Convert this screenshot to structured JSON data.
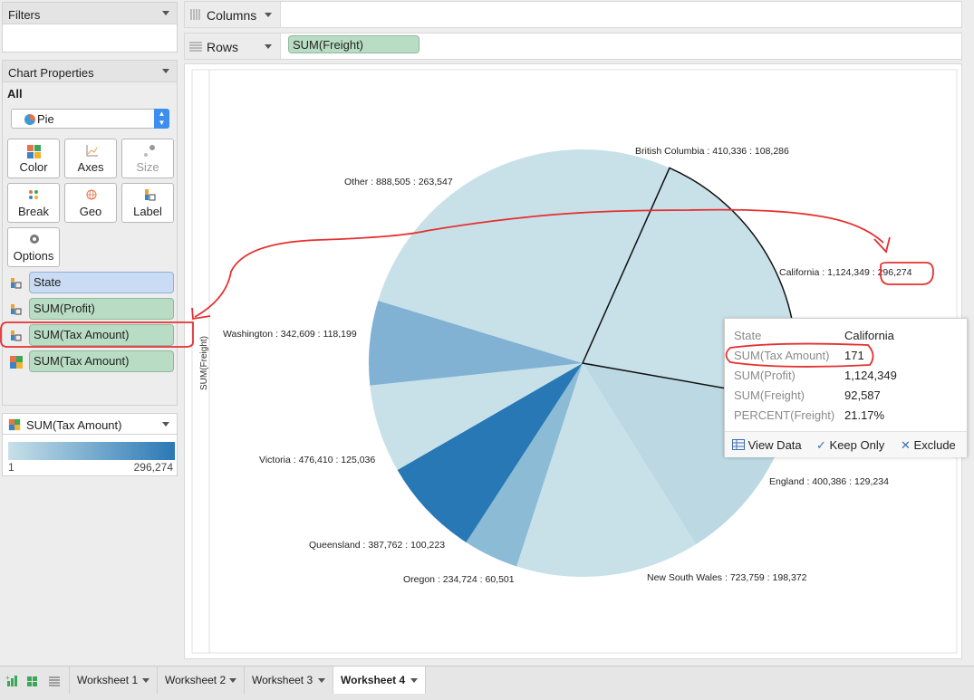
{
  "left_panel": {
    "filters_title": "Filters",
    "chart_properties_title": "Chart Properties",
    "all_label": "All",
    "chart_type": "Pie",
    "buttons": {
      "color": "Color",
      "axes": "Axes",
      "size": "Size",
      "break": "Break",
      "geo": "Geo",
      "label": "Label",
      "options": "Options"
    },
    "fields": [
      {
        "label": "State"
      },
      {
        "label": "SUM(Profit)"
      },
      {
        "label": "SUM(Tax Amount)"
      },
      {
        "label": "SUM(Tax Amount)"
      }
    ],
    "legend": {
      "title": "SUM(Tax Amount)",
      "min": "1",
      "max": "296,274"
    }
  },
  "shelves": {
    "columns_label": "Columns",
    "rows_label": "Rows",
    "rows_pill": "SUM(Freight)"
  },
  "chart": {
    "y_axis_label": "SUM(Freight)"
  },
  "chart_data": {
    "type": "pie",
    "slices": [
      {
        "name": "British Columbia",
        "profit": 410336,
        "tax_amount": 108286,
        "label": "British Columbia : 410,336 : 108,286",
        "color": "#c8e0e8"
      },
      {
        "name": "California",
        "profit": 1124349,
        "tax_amount": 296274,
        "label": "California : 1,124,349 : 296,274",
        "color": "#c8e0e8",
        "freight_percent": 21.17
      },
      {
        "name": "England",
        "profit": 400386,
        "tax_amount": 129234,
        "label": "England : 400,386 : 129,234",
        "color": "#bcd9e3"
      },
      {
        "name": "New South Wales",
        "profit": 723759,
        "tax_amount": 198372,
        "label": "New South Wales : 723,759 : 198,372",
        "color": "#c8e0e8"
      },
      {
        "name": "Oregon",
        "profit": 234724,
        "tax_amount": 60501,
        "label": "Oregon : 234,724 : 60,501",
        "color": "#8bbbd5"
      },
      {
        "name": "Queensland",
        "profit": 387762,
        "tax_amount": 100223,
        "label": "Queensland : 387,762 : 100,223",
        "color": "#2778b5"
      },
      {
        "name": "Victoria",
        "profit": 476410,
        "tax_amount": 125036,
        "label": "Victoria : 476,410 : 125,036",
        "color": "#c8e0e8"
      },
      {
        "name": "Washington",
        "profit": 342609,
        "tax_amount": 118199,
        "label": "Washington : 342,609 : 118,199",
        "color": "#81b2d3"
      },
      {
        "name": "Other",
        "profit": 888505,
        "tax_amount": 263547,
        "label": "Other : 888,505 : 263,547",
        "color": "#c8e0e8"
      }
    ]
  },
  "tooltip": {
    "rows": [
      {
        "key": "State",
        "value": "California"
      },
      {
        "key": "SUM(Tax Amount)",
        "value": "171"
      },
      {
        "key": "SUM(Profit)",
        "value": "1,124,349"
      },
      {
        "key": "SUM(Freight)",
        "value": "92,587"
      },
      {
        "key": "PERCENT(Freight)",
        "value": "21.17%"
      }
    ],
    "actions": {
      "view_data": "View Data",
      "keep_only": "Keep Only",
      "exclude": "Exclude"
    }
  },
  "tabs": [
    {
      "label": "Worksheet 1"
    },
    {
      "label": "Worksheet 2"
    },
    {
      "label": "Worksheet 3"
    },
    {
      "label": "Worksheet 4",
      "active": true
    }
  ],
  "colors": {
    "pill_green": "#b9ddc4",
    "pill_blue": "#c9dcf3",
    "annotation_red": "#e53030",
    "legend_low": "#c8e0e8",
    "legend_high": "#2a78b6"
  }
}
